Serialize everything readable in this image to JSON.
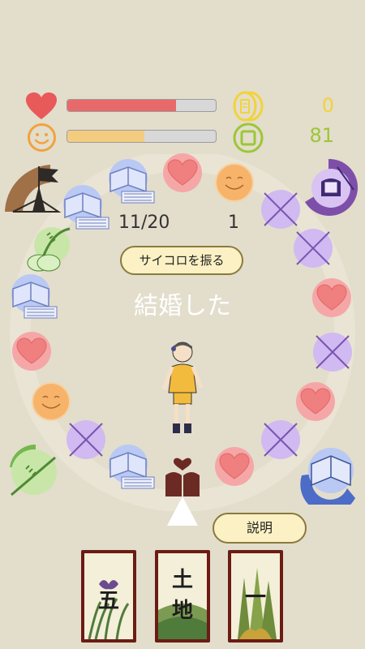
{
  "stats": {
    "health_level": 0.73,
    "mood_level": 0.52,
    "money_value": "0",
    "rice_value": "81"
  },
  "board": {
    "progress": "11/20",
    "dice_result": "1",
    "event_text": "結婚した"
  },
  "buttons": {
    "roll_dice": "サイコロを振る",
    "explain": "説明"
  },
  "cards": [
    {
      "kanji": "五"
    },
    {
      "kanji": "土\n地"
    },
    {
      "kanji": "一"
    }
  ],
  "colors": {
    "background": "#e3ddcc",
    "health_fill": "#e8696a",
    "mood_fill": "#f4cc80",
    "money_color": "#f2d338",
    "rice_color": "#9bc735",
    "heart": "#f07f7f",
    "smile": "#f4a24c",
    "crossed": "#c5a8e8",
    "book": "#aebff0",
    "card_border": "#6b1c14"
  },
  "icons": [
    "heart-icon",
    "smiley-icon",
    "coin-icon",
    "rice-icon",
    "book-icon",
    "crossed-swords-icon",
    "flag-castle-icon",
    "kendo-mask-icon",
    "bamboo-icon",
    "house-icon",
    "pointer-icon"
  ]
}
